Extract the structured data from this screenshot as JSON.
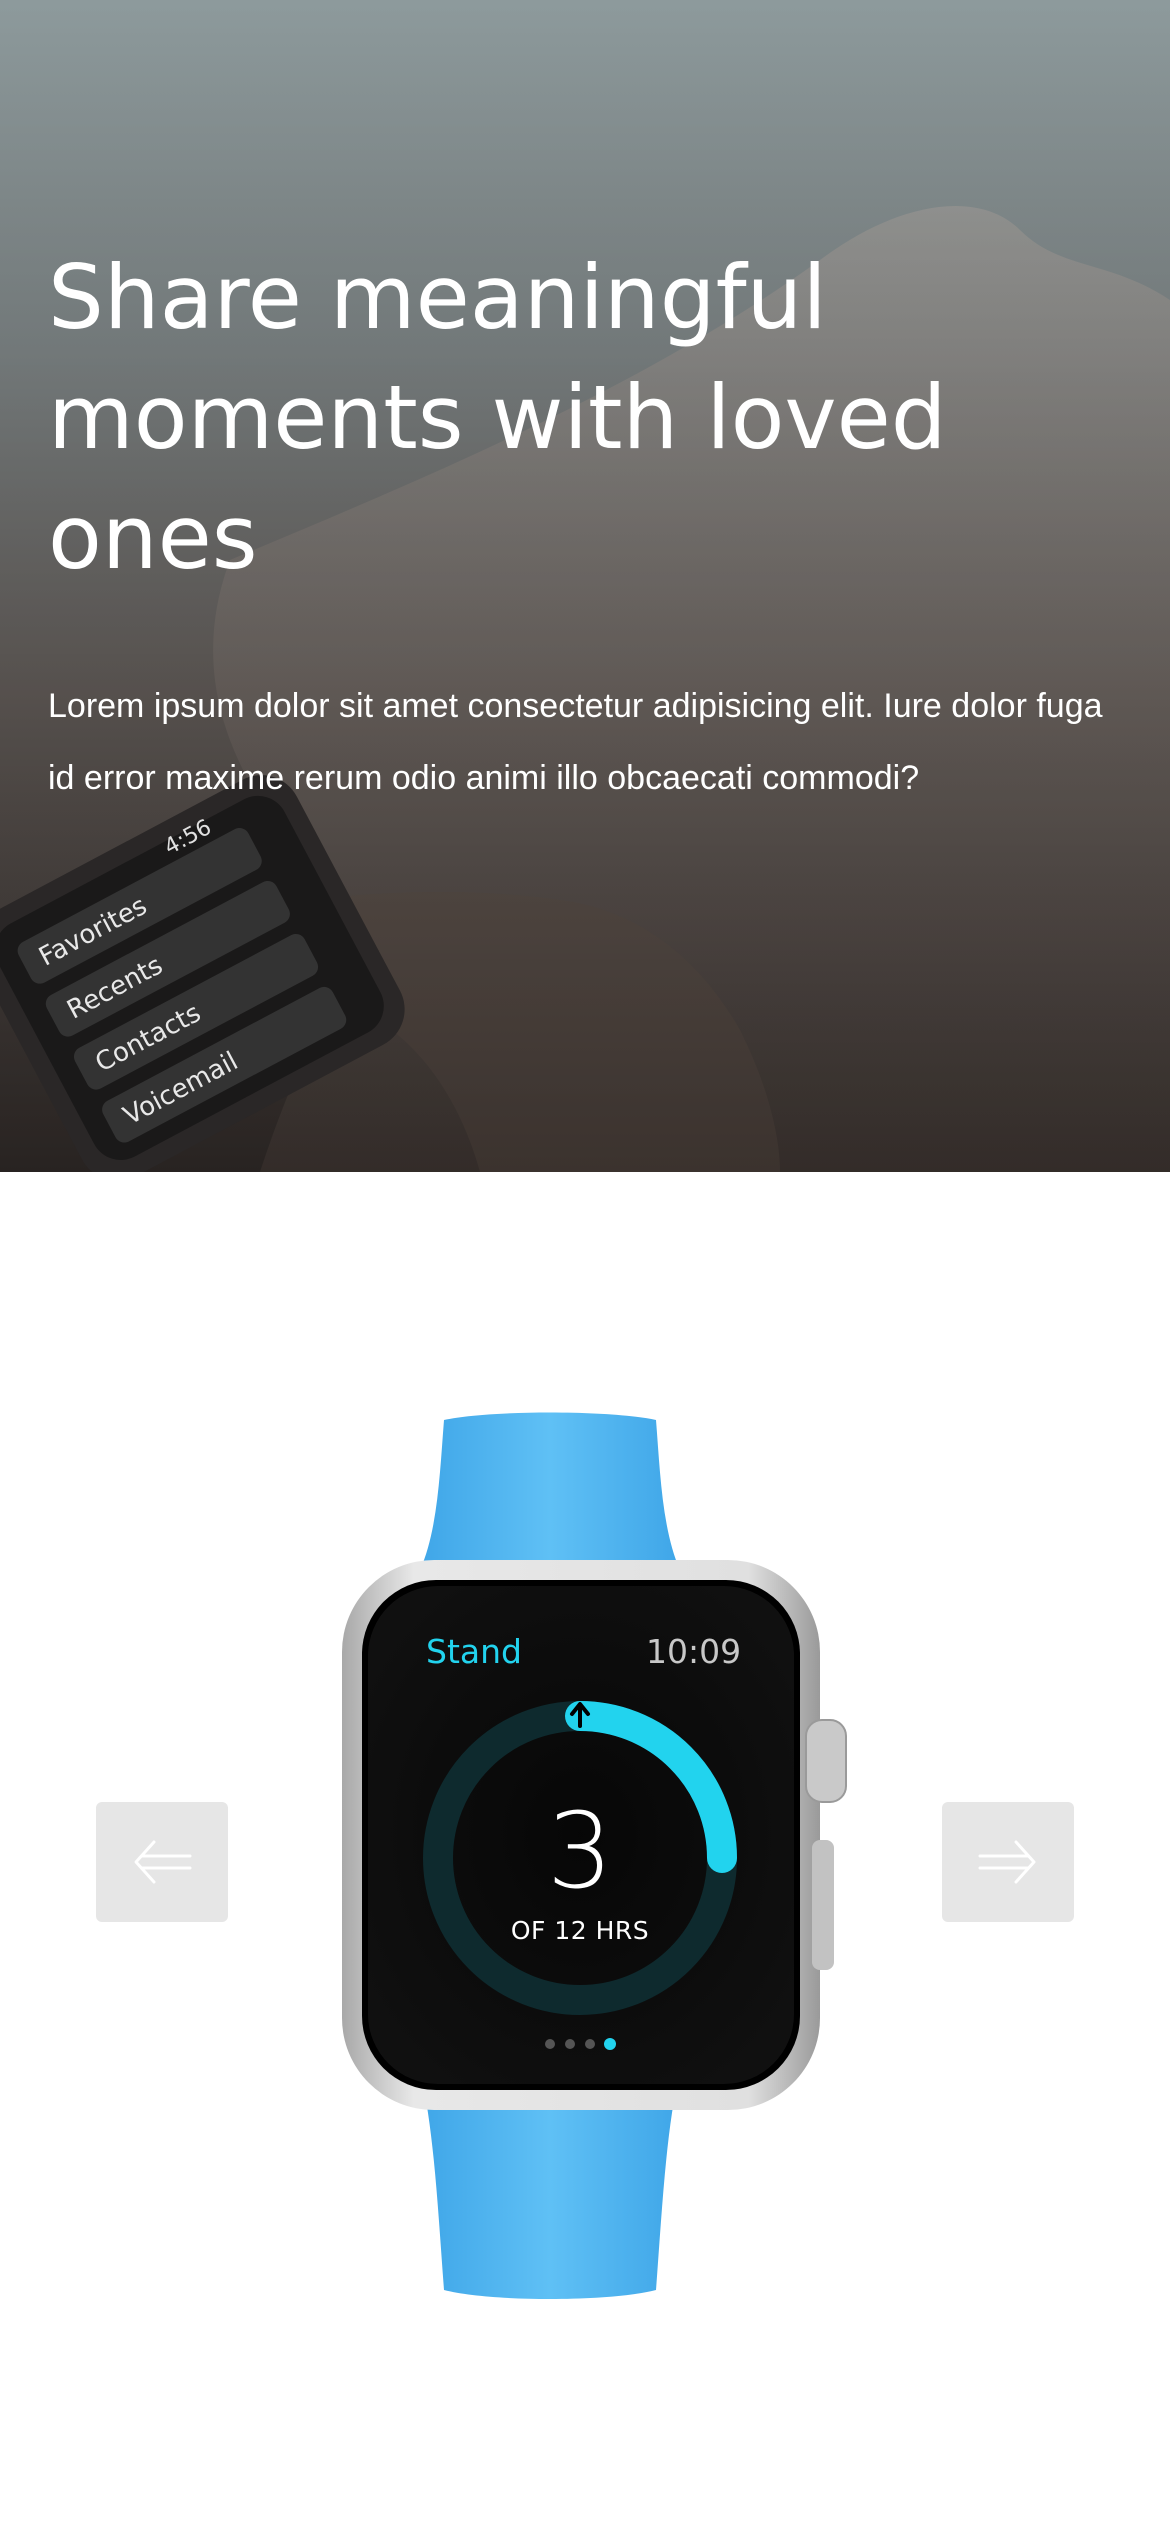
{
  "hero": {
    "title": "Share meaningful moments with loved ones",
    "text": "Lorem ipsum dolor sit amet consectetur adipisicing elit. Iure dolor fuga id error maxime rerum odio animi illo obcaecati commodi?",
    "watch_menu_items": [
      "4:56",
      "Favorites",
      "Recents",
      "Contacts",
      "Voicemail"
    ]
  },
  "carousel": {
    "prev_icon": "arrow-left-icon",
    "next_icon": "arrow-right-icon",
    "button_color": "#e6e6e6"
  },
  "watch": {
    "band_color": "#4fb3f0",
    "app_label": "Stand",
    "time": "10:09",
    "value": "3",
    "subtitle": "OF 12 HRS",
    "progress": 0.25,
    "accent_color": "#22d3ee",
    "page_dots": 4,
    "active_dot": 4
  }
}
